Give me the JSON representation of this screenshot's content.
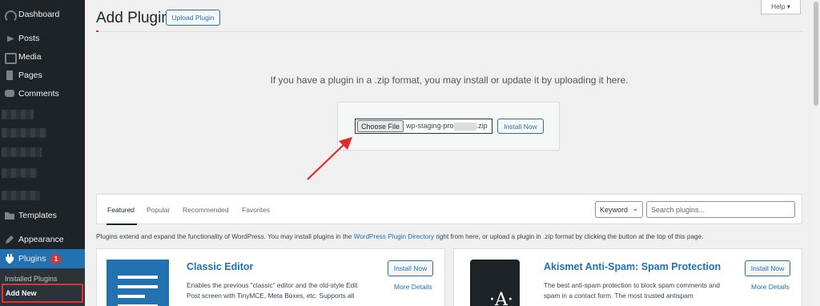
{
  "sidebar": {
    "items": [
      {
        "label": "Dashboard",
        "icon": "dashboard-icon"
      },
      {
        "label": "Posts",
        "icon": "posts-icon"
      },
      {
        "label": "Media",
        "icon": "media-icon"
      },
      {
        "label": "Pages",
        "icon": "pages-icon"
      },
      {
        "label": "Comments",
        "icon": "comments-icon"
      },
      {
        "label": "Templates",
        "icon": "templates-icon"
      },
      {
        "label": "Appearance",
        "icon": "appearance-icon"
      },
      {
        "label": "Plugins",
        "icon": "plugins-icon",
        "badge": "1"
      }
    ],
    "submenu": {
      "installed": "Installed Plugins",
      "add_new": "Add New"
    }
  },
  "header": {
    "title": "Add Plugins",
    "upload_label": "Upload Plugin",
    "help_label": "Help ▾"
  },
  "upload": {
    "instructions": "If you have a plugin in a .zip format, you may install or update it by uploading it here.",
    "choose_file_label": "Choose File",
    "file_name_prefix": "wp-staging-pro",
    "file_name_suffix": ".zip",
    "install_label": "Install Now"
  },
  "filter": {
    "tabs": [
      "Featured",
      "Popular",
      "Recommended",
      "Favorites"
    ],
    "keyword_label": "Keyword",
    "search_placeholder": "Search plugins..."
  },
  "info": {
    "before": "Plugins extend and expand the functionality of WordPress. You may install plugins in the ",
    "link": "WordPress Plugin Directory",
    "after": " right from here, or upload a plugin in .zip format by clicking the button at the top of this page."
  },
  "cards": [
    {
      "title": "Classic Editor",
      "desc": "Enables the previous \"classic\" editor and the old-style Edit Post screen with TinyMCE, Meta Boxes, etc. Supports all",
      "install": "Install Now",
      "more": "More Details"
    },
    {
      "title": "Akismet Anti-Spam: Spam Protection",
      "desc": "The best anti-spam protection to block spam comments and spam in a contact form. The most trusted antispam",
      "install": "Install Now",
      "more": "More Details",
      "icon_letter": "·A·"
    }
  ],
  "colors": {
    "sidebar_bg": "#1d2327",
    "accent": "#2271b1",
    "highlight": "#d63638"
  }
}
